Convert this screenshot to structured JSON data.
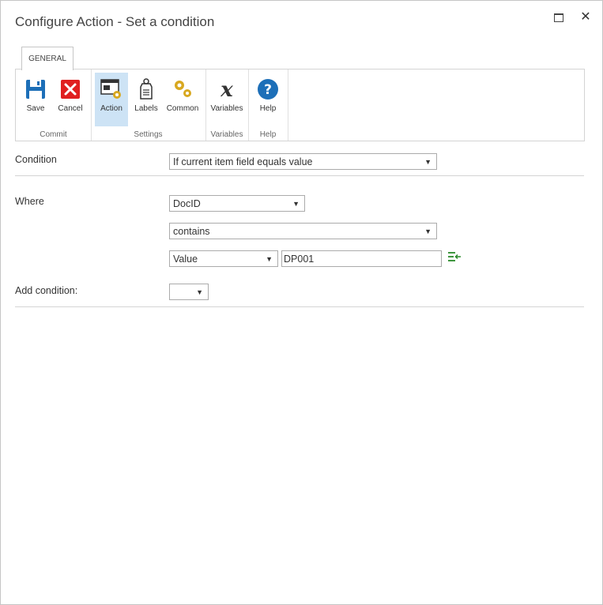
{
  "dialog": {
    "title": "Configure Action - Set a condition",
    "close_glyph": "✕"
  },
  "ribbon": {
    "tab_label": "GENERAL",
    "groups": {
      "commit": {
        "label": "Commit",
        "save": "Save",
        "cancel": "Cancel"
      },
      "settings": {
        "label": "Settings",
        "action": "Action",
        "labels": "Labels",
        "common": "Common"
      },
      "variables": {
        "label": "Variables",
        "variables": "Variables"
      },
      "help": {
        "label": "Help",
        "help": "Help"
      }
    }
  },
  "form": {
    "condition": {
      "label": "Condition",
      "value": "If current item field equals value"
    },
    "where": {
      "label": "Where",
      "field": "DocID",
      "operator": "contains",
      "value_type": "Value",
      "value": "DP001"
    },
    "add_condition": {
      "label": "Add condition:",
      "value": ""
    }
  },
  "colors": {
    "save_icon": "#1d6fb8",
    "cancel_icon": "#e02020",
    "help_icon": "#1d6fb8",
    "gear": "#d8a820",
    "picker": "#2a8a2a"
  }
}
